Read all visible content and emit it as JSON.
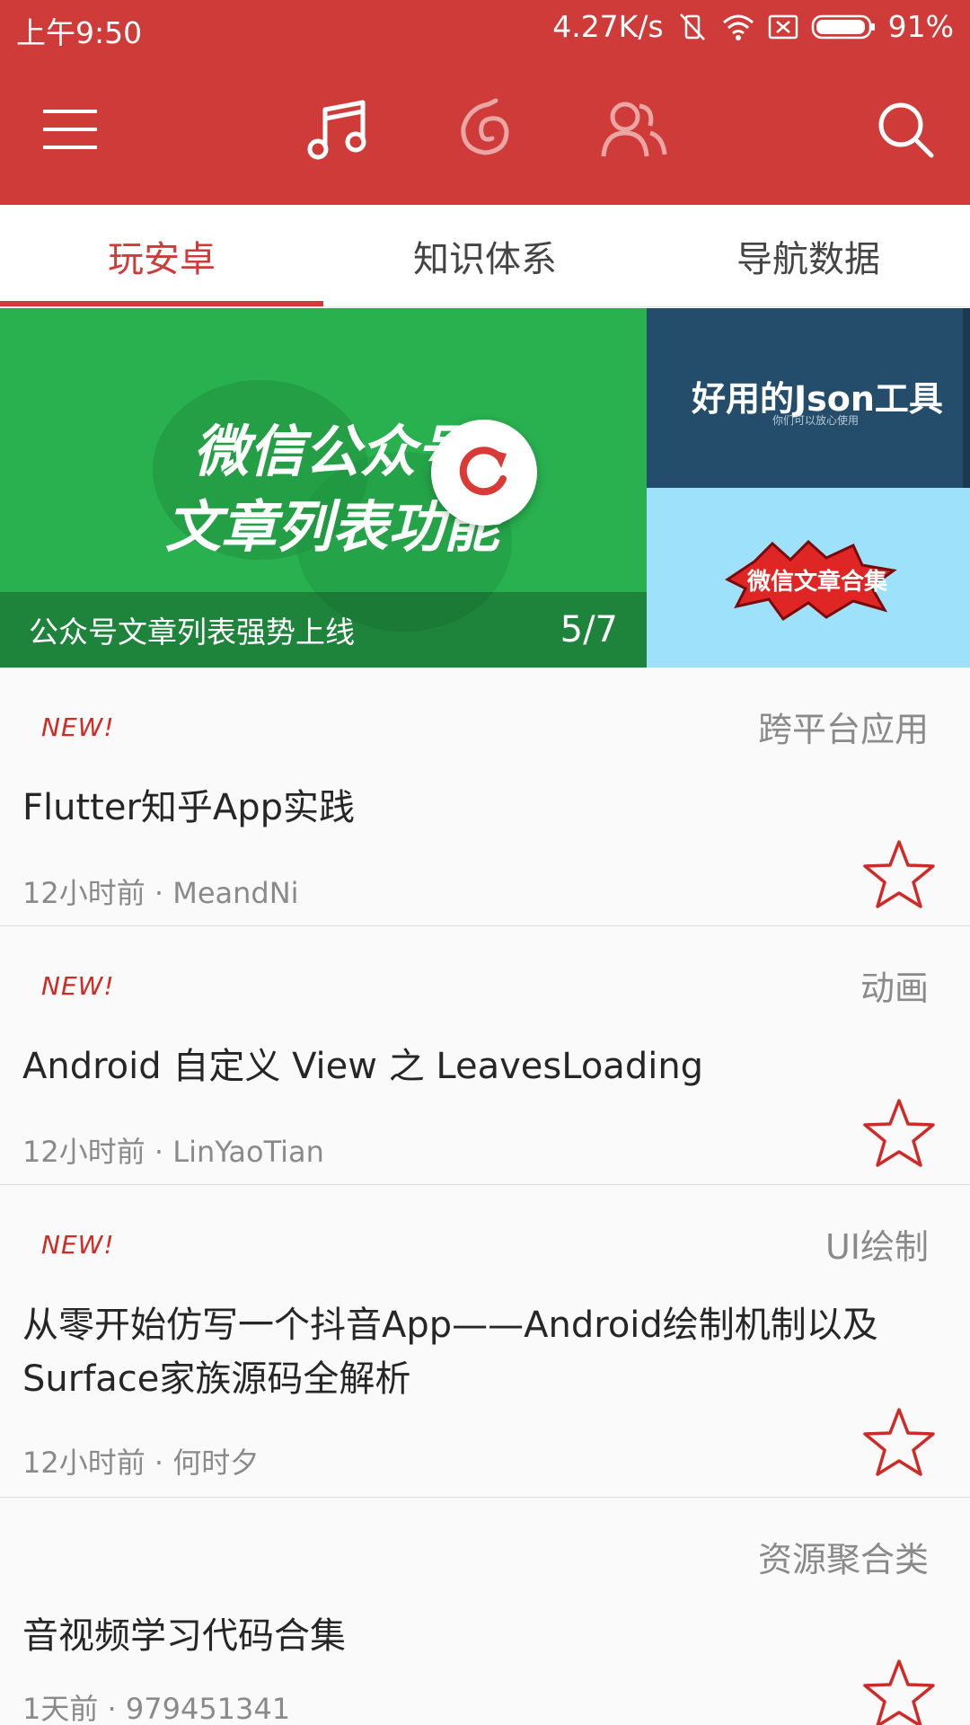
{
  "statusbar": {
    "time": "上午9:50",
    "network_speed": "4.27K/s",
    "battery": "91%",
    "icons": [
      "vibrate-off-icon",
      "wifi-icon",
      "sim-off-icon",
      "battery-icon"
    ]
  },
  "header": {
    "icons": [
      "menu-icon",
      "music-icon",
      "netease-icon",
      "friends-icon",
      "search-icon"
    ]
  },
  "tabs": [
    {
      "label": "玩安卓",
      "active": true
    },
    {
      "label": "知识体系",
      "active": false
    },
    {
      "label": "导航数据",
      "active": false
    }
  ],
  "banner": {
    "main_title_line1": "微信公众号",
    "main_title_line2": "文章列表功能",
    "caption": "公众号文章列表强势上线",
    "counter": "5/7",
    "side_top_title": "好用的Json工具",
    "side_top_subtitle": "你们可以放心使用",
    "side_bottom_label": "微信文章合集"
  },
  "articles": [
    {
      "is_new": true,
      "new_label": "NEW!",
      "category": "跨平台应用",
      "title": "Flutter知乎App实践",
      "meta": "12小时前 · MeandNi"
    },
    {
      "is_new": true,
      "new_label": "NEW!",
      "category": "动画",
      "title": "Android 自定义 View 之 LeavesLoading",
      "meta": "12小时前 · LinYaoTian"
    },
    {
      "is_new": true,
      "new_label": "NEW!",
      "category": "UI绘制",
      "title": "从零开始仿写一个抖音App——Android绘制机制以及Surface家族源码全解析",
      "meta": "12小时前 ·  何时夕"
    },
    {
      "is_new": false,
      "new_label": "",
      "category": "资源聚合类",
      "title": "音视频学习代码合集",
      "meta": "1天前 · 979451341"
    }
  ],
  "colors": {
    "primary": "#cf3b38",
    "banner_green": "#29b04f",
    "new_badge": "#d02a22"
  }
}
